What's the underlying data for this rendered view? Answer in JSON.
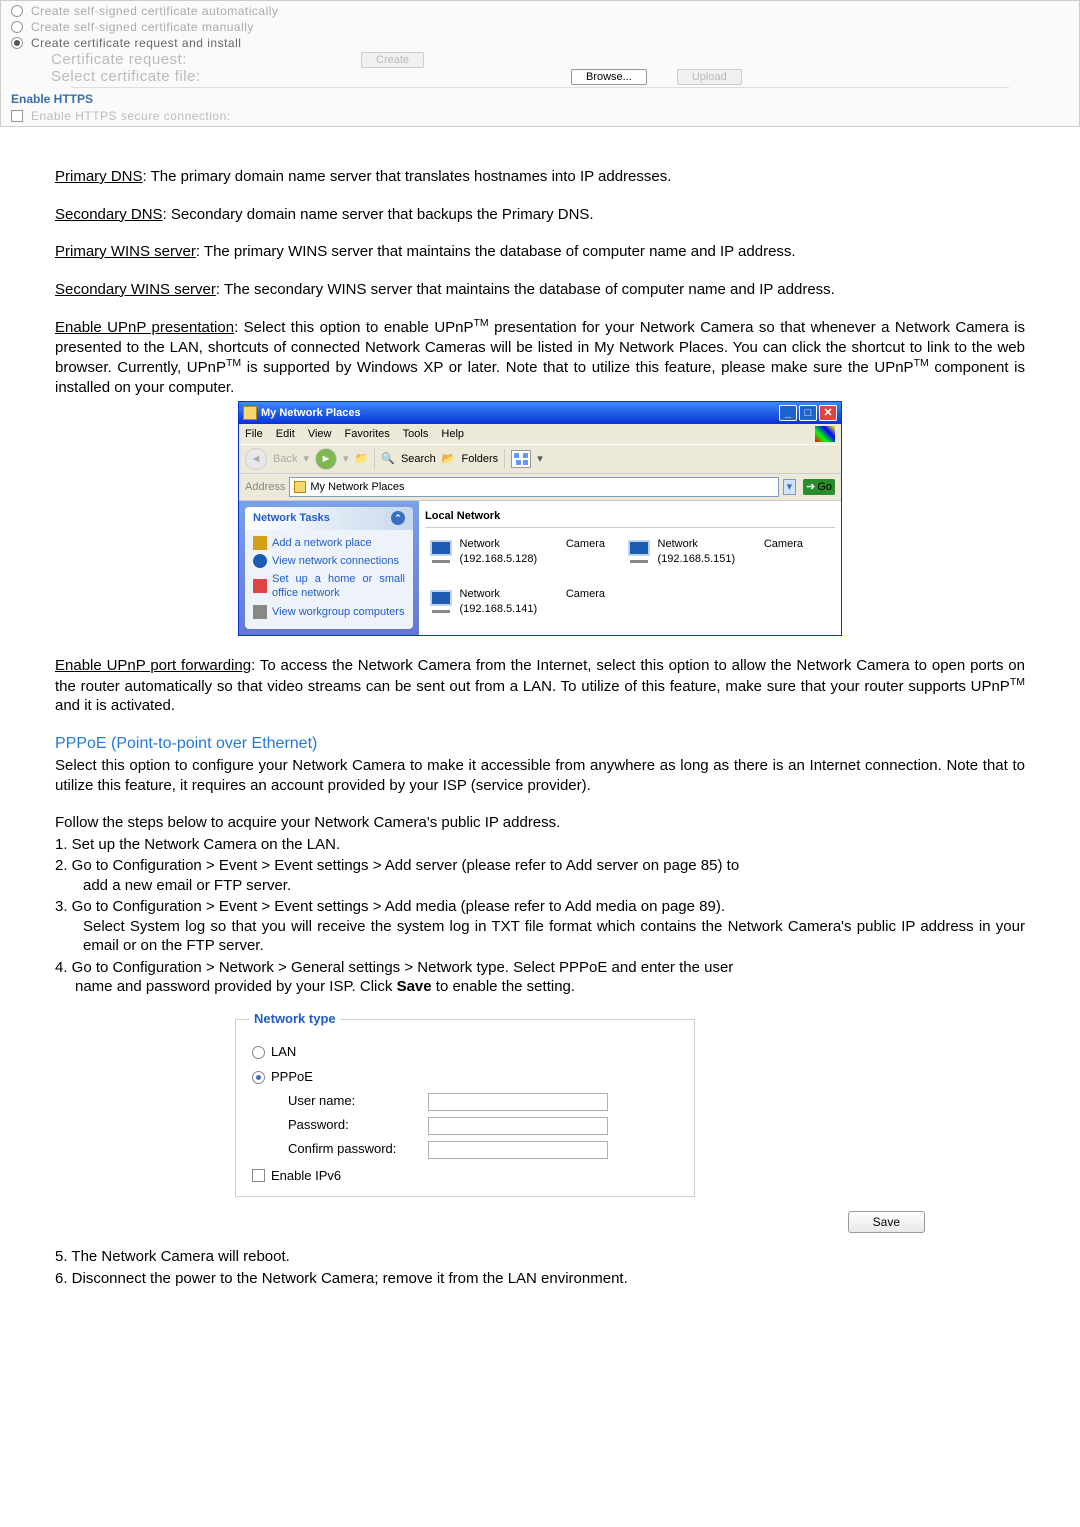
{
  "top": {
    "opt_auto": "Create self-signed certificate automatically",
    "opt_manual": "Create self-signed certificate manually",
    "opt_request": "Create certificate request and install",
    "sub_request": "Certificate request:",
    "sub_select": "Select certificate file:",
    "btn_create": "Create",
    "btn_browse": "Browse...",
    "btn_upload": "Upload",
    "https_head": "Enable HTTPS",
    "https_chk": "Enable HTTPS secure connection:"
  },
  "doc": {
    "dns1_l": "Primary DNS",
    "dns1_t": ": The primary domain name server that translates hostnames into IP addresses.",
    "dns2_l": "Secondary DNS",
    "dns2_t": ": Secondary domain name server that backups the Primary DNS.",
    "wins1_l": "Primary WINS server",
    "wins1_t": ": The primary WINS server that maintains the database of computer name and IP address.",
    "wins2_l": "Secondary WINS server",
    "wins2_t": ": The secondary WINS server that maintains the database of computer name and IP address.",
    "upnp_pres_l": "Enable UPnP presentation",
    "upnp_pres_t1": ": Select this option to enable UPnP",
    "upnp_pres_t2": " presentation for your Network Camera so that whenever a Network Camera is presented to the LAN, shortcuts of connected Network Cameras will be listed in My Network Places. You can click the shortcut to link to the web browser. Currently, UPnP",
    "upnp_pres_t3": " is supported by Windows XP or later. Note that to utilize this feature, please make sure the UPnP",
    "upnp_pres_t4": " component is installed on your computer.",
    "upnp_fwd_l": "Enable UPnP port forwarding",
    "upnp_fwd_t1": ": To access the Network Camera from the Internet, select this option to allow the Network Camera to open ports on the router automatically so that video streams can be sent out from a LAN. To utilize of this feature, make sure that your router supports UPnP",
    "upnp_fwd_t2": " and it is activated.",
    "pppoe_title": "PPPoE (Point-to-point over Ethernet)",
    "pppoe_intro": "Select this option to configure your Network Camera to make it accessible from anywhere as long as there is an Internet connection. Note that to utilize this feature, it requires an account provided by your ISP (service provider).",
    "steps_intro": "Follow the steps below to acquire your Network Camera's public IP address.",
    "step1": "1. Set up the Network Camera on the LAN.",
    "step2a": "2. Go to Configuration > Event > Event settings > Add server (please refer to Add server on page 85) to",
    "step2b": "add a new email or FTP server.",
    "step3a": "3. Go to Configuration > Event > Event settings > Add media (please refer to Add media on page 89).",
    "step3b": "Select System log so that you will receive the system log in TXT file format which contains the Network Camera's public IP address in your email or on the FTP server.",
    "step4a": "4. Go to Configuration > Network > General settings > Network type. Select PPPoE and enter the user",
    "step4b": "name and password provided by your ISP. Click ",
    "step4c": "Save",
    "step4d": " to enable the setting.",
    "step5": "5. The Network Camera will reboot.",
    "step6": "6. Disconnect the power to the Network Camera; remove it from the LAN environment."
  },
  "xp": {
    "title": "My Network Places",
    "menus": [
      "File",
      "Edit",
      "View",
      "Favorites",
      "Tools",
      "Help"
    ],
    "back": "Back",
    "search": "Search",
    "folders": "Folders",
    "addr_label": "Address",
    "addr_val": "My Network Places",
    "go": "Go",
    "side_head": "Network Tasks",
    "side_items": [
      "Add a network place",
      "View network connections",
      "Set up a home or small office network",
      "View workgroup computers"
    ],
    "group": "Local Network",
    "cameras": [
      "Network Camera (192.168.5.128)",
      "Network Camera (192.168.5.151)",
      "Network Camera (192.168.5.141)"
    ]
  },
  "net": {
    "legend": "Network type",
    "lan": "LAN",
    "pppoe": "PPPoE",
    "user": "User name:",
    "pass": "Password:",
    "confirm": "Confirm password:",
    "ipv6": "Enable IPv6",
    "save": "Save"
  },
  "tm": "TM"
}
